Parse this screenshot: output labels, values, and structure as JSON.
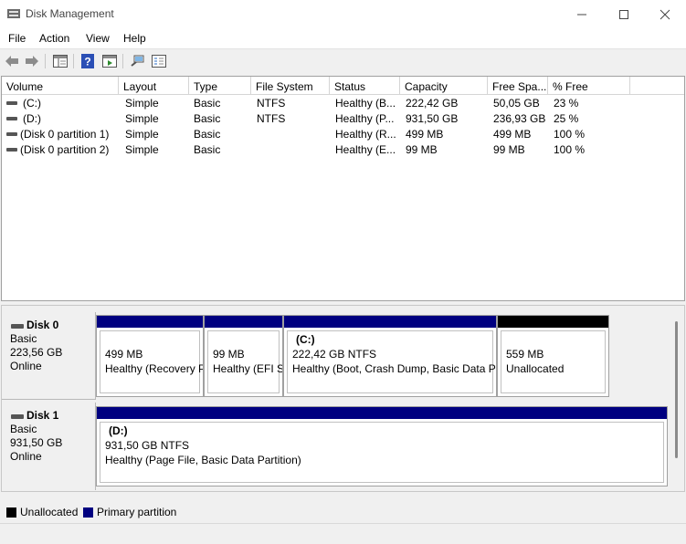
{
  "window": {
    "title": "Disk Management"
  },
  "menu": [
    "File",
    "Action",
    "View",
    "Help"
  ],
  "volume_list": {
    "columns": [
      "Volume",
      "Layout",
      "Type",
      "File System",
      "Status",
      "Capacity",
      "Free Spa...",
      "% Free"
    ],
    "rows": [
      [
        "(C:)",
        "Simple",
        "Basic",
        "NTFS",
        "Healthy (B...",
        "222,42 GB",
        "50,05 GB",
        "23 %"
      ],
      [
        "(D:)",
        "Simple",
        "Basic",
        "NTFS",
        "Healthy (P...",
        "931,50 GB",
        "236,93 GB",
        "25 %"
      ],
      [
        "(Disk 0 partition 1)",
        "Simple",
        "Basic",
        "",
        "Healthy (R...",
        "499 MB",
        "499 MB",
        "100 %"
      ],
      [
        "(Disk 0 partition 2)",
        "Simple",
        "Basic",
        "",
        "Healthy (E...",
        "99 MB",
        "99 MB",
        "100 %"
      ]
    ]
  },
  "disks": [
    {
      "name": "Disk 0",
      "type": "Basic",
      "size": "223,56 GB",
      "state": "Online",
      "partitions": [
        {
          "title": "",
          "size": "499 MB",
          "status": "Healthy (Recovery P",
          "kind": "primary"
        },
        {
          "title": "",
          "size": "99 MB",
          "status": "Healthy (EFI S",
          "kind": "primary"
        },
        {
          "title": "(C:)",
          "size": "222,42 GB NTFS",
          "status": "Healthy (Boot, Crash Dump, Basic Data Pa",
          "kind": "primary"
        },
        {
          "title": "",
          "size": "559 MB",
          "status": "Unallocated",
          "kind": "unallocated"
        }
      ]
    },
    {
      "name": "Disk 1",
      "type": "Basic",
      "size": "931,50 GB",
      "state": "Online",
      "partitions": [
        {
          "title": "(D:)",
          "size": "931,50 GB NTFS",
          "status": "Healthy (Page File, Basic Data Partition)",
          "kind": "primary"
        }
      ]
    }
  ],
  "legend": [
    {
      "label": "Unallocated",
      "color": "#000000"
    },
    {
      "label": "Primary partition",
      "color": "#000080"
    }
  ],
  "colors": {
    "primary": "#000080",
    "unallocated": "#000000"
  },
  "toolbar_icons": [
    "back-arrow-icon",
    "forward-arrow-icon",
    "show-hide-console-tree-icon",
    "help-icon",
    "show-hide-action-pane-icon",
    "connect-icon",
    "properties-icon"
  ]
}
